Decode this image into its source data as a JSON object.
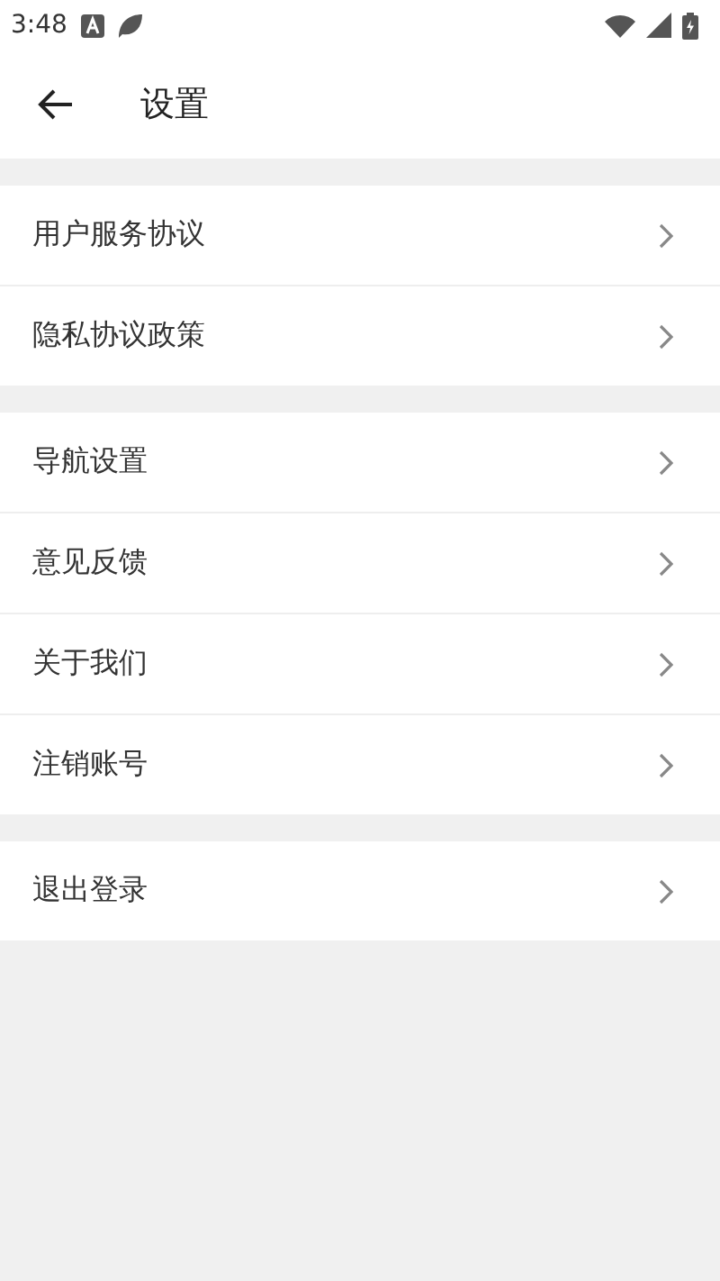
{
  "status_bar": {
    "time": "3:48"
  },
  "header": {
    "title": "设置"
  },
  "groups": [
    {
      "items": [
        {
          "label": "用户服务协议"
        },
        {
          "label": "隐私协议政策"
        }
      ]
    },
    {
      "items": [
        {
          "label": "导航设置"
        },
        {
          "label": "意见反馈"
        },
        {
          "label": "关于我们"
        },
        {
          "label": "注销账号"
        }
      ]
    },
    {
      "items": [
        {
          "label": "退出登录"
        }
      ]
    }
  ]
}
